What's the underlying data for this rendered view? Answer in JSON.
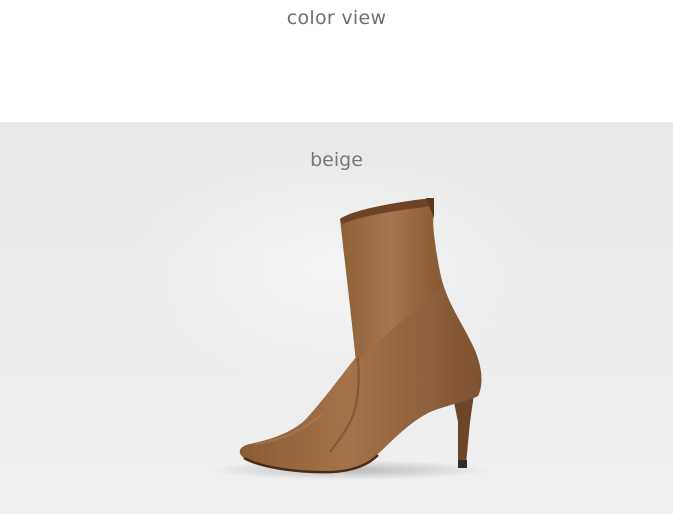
{
  "header": {
    "title": "color view"
  },
  "swatch": {
    "color_name": "beige",
    "product_icon": "ankle-boot-icon",
    "boot_color": "#9a6a3f",
    "background_color": "#ebebeb"
  }
}
